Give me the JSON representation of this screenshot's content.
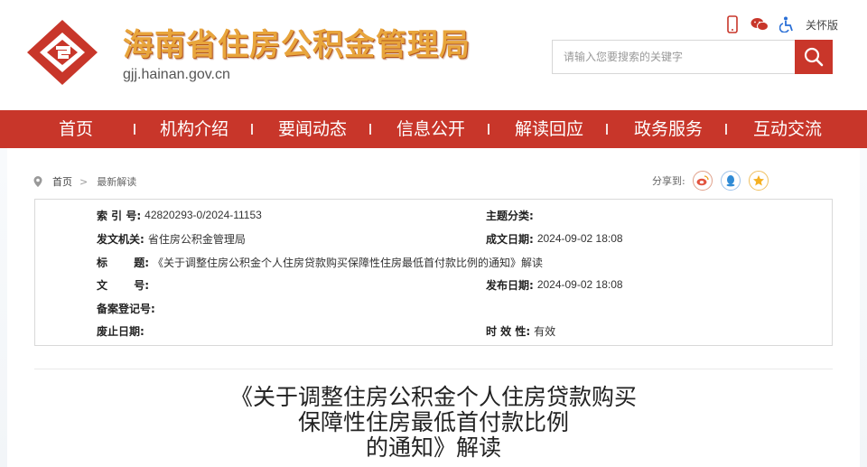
{
  "header": {
    "site_title": "海南省住房公积金管理局",
    "site_url": "gjj.hainan.gov.cn",
    "care_label": "关怀版",
    "icons": [
      "mobile-icon",
      "wechat-icon",
      "accessibility-icon"
    ],
    "search_placeholder": "请输入您要搜索的关键字",
    "brand_color": "#c8362a",
    "title_color": "#e8a53c"
  },
  "nav": {
    "items": [
      "首页",
      "机构介绍",
      "要闻动态",
      "信息公开",
      "解读回应",
      "政务服务",
      "互动交流"
    ]
  },
  "breadcrumb": {
    "home": "首页",
    "separator": ">",
    "current": "最新解读"
  },
  "share": {
    "label": "分享到:",
    "icons": [
      "weibo-icon",
      "qq-icon",
      "qzone-icon"
    ]
  },
  "info": {
    "index_no_label": "索 引 号:",
    "index_no": "42820293-0/2024-11153",
    "topic_label": "主题分类:",
    "topic": "",
    "issuer_label": "发文机关:",
    "issuer": "省住房公积金管理局",
    "created_label": "成文日期:",
    "created": "2024-09-02 18:08",
    "title_label": "标       题:",
    "title": "《关于调整住房公积金个人住房贷款购买保障性住房最低首付款比例的通知》解读",
    "doc_no_label": "文       号:",
    "doc_no": "",
    "published_label": "发布日期:",
    "published": "2024-09-02 18:08",
    "record_label": "备案登记号:",
    "record": "",
    "repeal_label": "废止日期:",
    "repeal": "",
    "validity_label": "时 效 性:",
    "validity": "有效"
  },
  "article": {
    "title_lines": [
      "《关于调整住房公积金个人住房贷款购买",
      "保障性住房最低首付款比例",
      "的通知》解读"
    ]
  }
}
